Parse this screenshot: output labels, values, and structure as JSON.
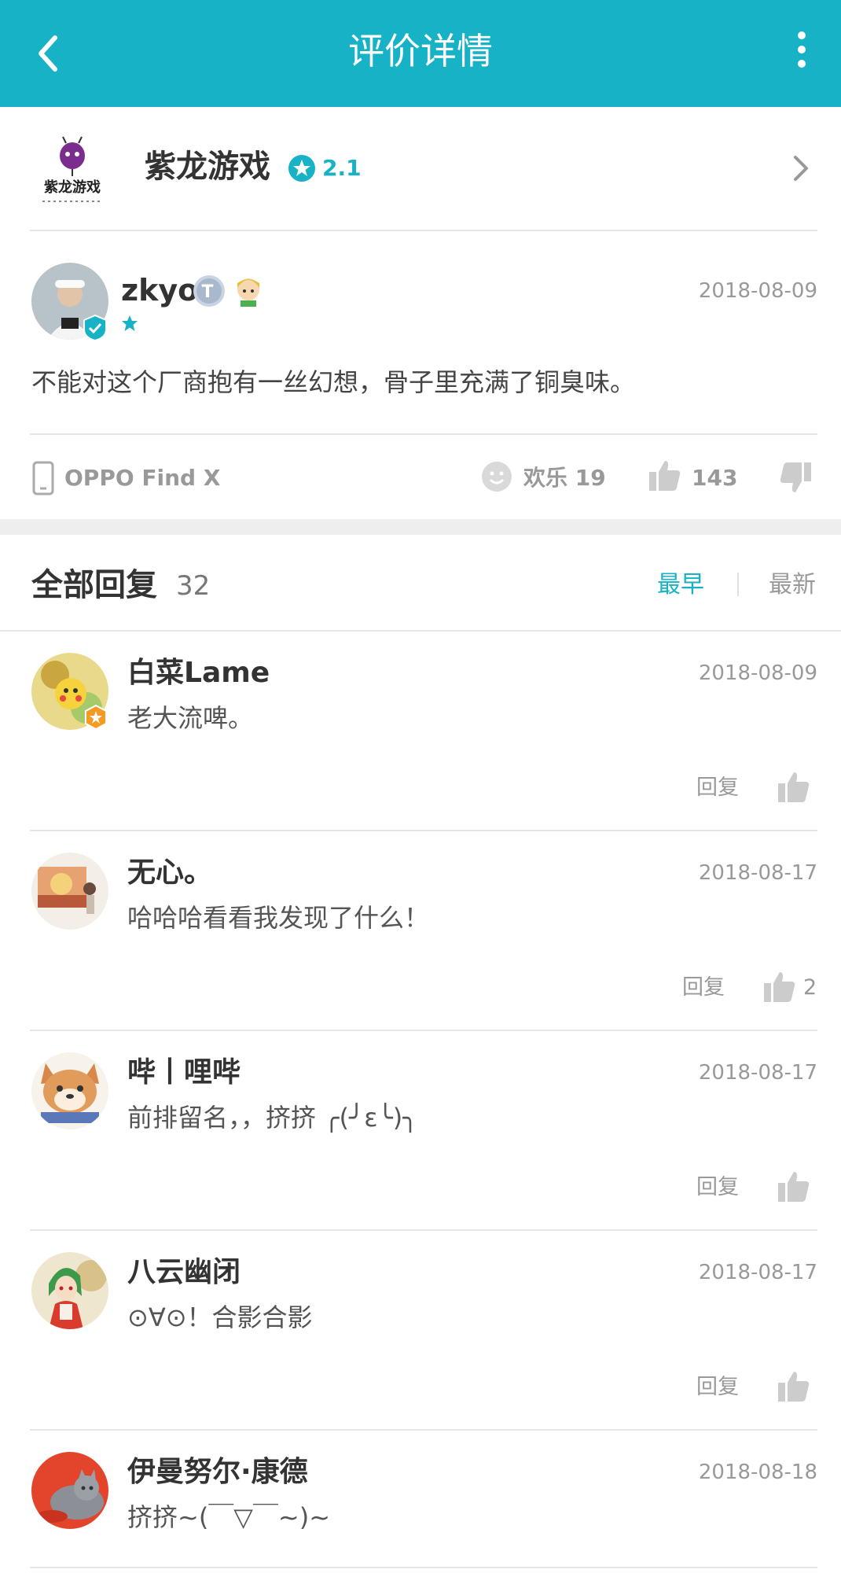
{
  "header": {
    "title": "评价详情"
  },
  "game": {
    "name": "紫龙游戏",
    "rating": "2.1",
    "logo_text": "紫龙游戏"
  },
  "review": {
    "author": "zkyo",
    "badge_text": "T",
    "date": "2018-08-09",
    "text": "不能对这个厂商抱有一丝幻想，骨子里充满了铜臭味。",
    "device": "OPPO Find X",
    "mood": "欢乐 19",
    "likes": "143"
  },
  "replies_header": {
    "title": "全部回复",
    "count": "32",
    "sort_earliest": "最早",
    "sort_latest": "最新"
  },
  "replies": [
    {
      "name": "白菜Lame",
      "date": "2018-08-09",
      "text": "老大流啤。",
      "reply_label": "回复",
      "likes": ""
    },
    {
      "name": "无心。",
      "date": "2018-08-17",
      "text": "哈哈哈看看我发现了什么！",
      "reply_label": "回复",
      "likes": "2"
    },
    {
      "name": "哔丨哩哔",
      "date": "2018-08-17",
      "text": "前排留名，，挤挤 ╭(╯ε╰)╮",
      "reply_label": "回复",
      "likes": ""
    },
    {
      "name": "八云幽闭",
      "date": "2018-08-17",
      "text": "⊙∀⊙！合影合影",
      "reply_label": "回复",
      "likes": ""
    },
    {
      "name": "伊曼努尔·康德",
      "date": "2018-08-18",
      "text": "挤挤~(￣▽￣~)~",
      "reply_label": "",
      "likes": ""
    }
  ],
  "colors": {
    "accent": "#17b2c5",
    "text": "#333333",
    "muted": "#999999"
  }
}
